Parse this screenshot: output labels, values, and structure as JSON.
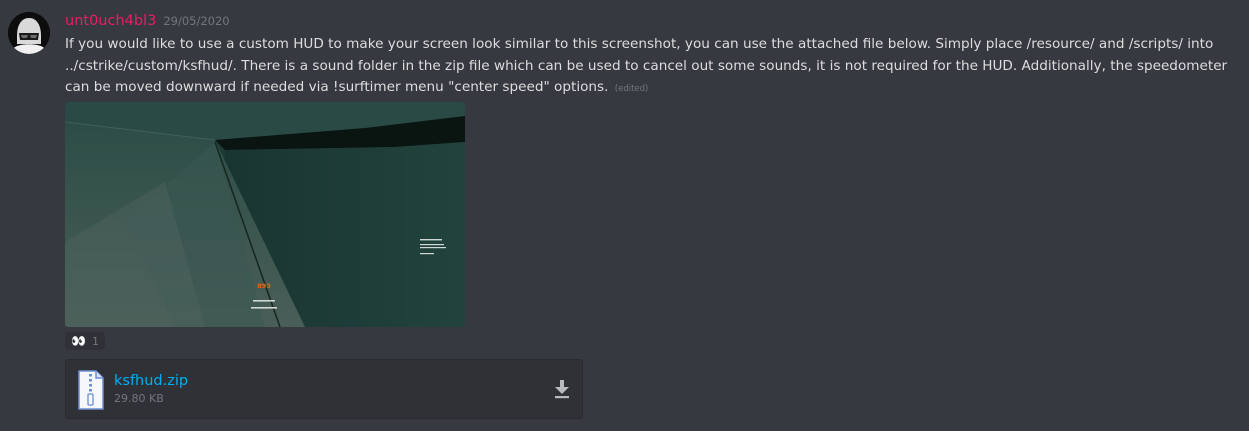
{
  "message": {
    "author": "unt0uch4bl3",
    "author_color": "#e91e63",
    "timestamp": "29/05/2020",
    "text": "If you would like to use a custom HUD to make your screen look similar to this screenshot, you can use the attached file below. Simply place /resource/ and /scripts/ into ../cstrike/custom/ksfhud/. There is a sound folder in the zip file which can be used to cancel out some sounds, it is not required for the HUD. Additionally, the speedometer can be moved downward if needed via !surftimer menu \"center speed\" options.",
    "edited_label": "(edited)"
  },
  "screenshot": {
    "speed_value": "893",
    "speed_color": "#e8621c"
  },
  "reaction": {
    "emoji": "👀",
    "count": "1"
  },
  "attachment": {
    "file_name": "ksfhud.zip",
    "file_size": "29.80 KB",
    "link_color": "#00aff4"
  },
  "icons": {
    "file": "archive-file-icon",
    "download": "download-icon"
  }
}
